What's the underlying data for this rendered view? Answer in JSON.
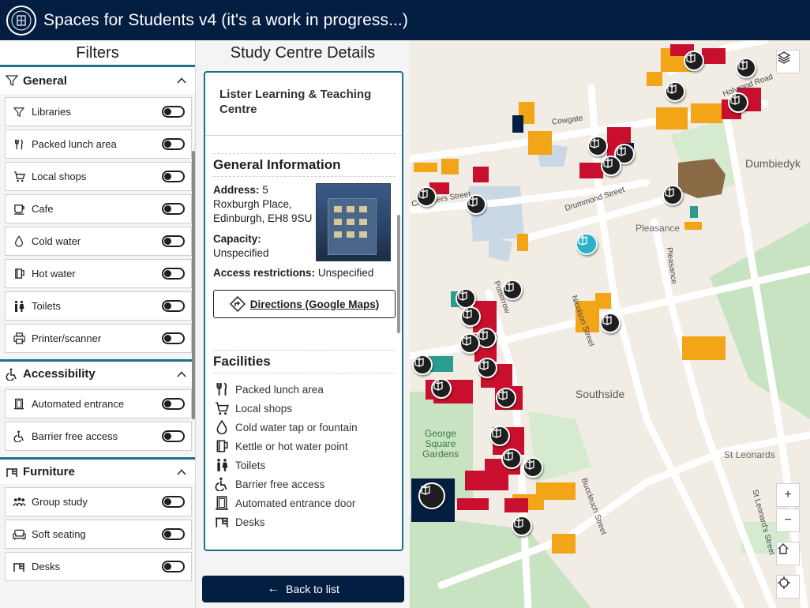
{
  "header": {
    "title": "Spaces for Students v4 (it's a work in progress...)",
    "logo_icon": "university-crest-icon"
  },
  "filters": {
    "title": "Filters",
    "groups": [
      {
        "label": "General",
        "icon": "filter-icon",
        "items": [
          {
            "label": "Libraries",
            "icon": "filter-icon",
            "on": false
          },
          {
            "label": "Packed lunch area",
            "icon": "cutlery-icon",
            "on": false
          },
          {
            "label": "Local shops",
            "icon": "cart-icon",
            "on": false
          },
          {
            "label": "Cafe",
            "icon": "cup-icon",
            "on": false
          },
          {
            "label": "Cold water",
            "icon": "water-drop-icon",
            "on": false
          },
          {
            "label": "Hot water",
            "icon": "kettle-icon",
            "on": false
          },
          {
            "label": "Toilets",
            "icon": "toilets-icon",
            "on": false
          },
          {
            "label": "Printer/scanner",
            "icon": "printer-icon",
            "on": false
          }
        ]
      },
      {
        "label": "Accessibility",
        "icon": "wheelchair-icon",
        "items": [
          {
            "label": "Automated entrance",
            "icon": "door-icon",
            "on": false
          },
          {
            "label": "Barrier free access",
            "icon": "wheelchair-icon",
            "on": false
          }
        ]
      },
      {
        "label": "Furniture",
        "icon": "desk-icon",
        "items": [
          {
            "label": "Group study",
            "icon": "group-icon",
            "on": false
          },
          {
            "label": "Soft seating",
            "icon": "sofa-icon",
            "on": false
          },
          {
            "label": "Desks",
            "icon": "desk-icon",
            "on": false
          }
        ]
      }
    ]
  },
  "details": {
    "title": "Study Centre Details",
    "name": "Lister Learning & Teaching Centre",
    "general_heading": "General Information",
    "address_label": "Address:",
    "address_value": "5 Roxburgh Place, Edinburgh, EH8 9SU",
    "capacity_label": "Capacity:",
    "capacity_value": "Unspecified",
    "access_label": "Access restrictions:",
    "access_value": "Unspecified",
    "directions_label": "Directions (Google Maps)",
    "facilities_heading": "Facilities",
    "facilities": [
      {
        "label": "Packed lunch area",
        "icon": "cutlery-icon"
      },
      {
        "label": "Local shops",
        "icon": "cart-icon"
      },
      {
        "label": "Cold water tap or fountain",
        "icon": "water-drop-icon"
      },
      {
        "label": "Kettle or hot water point",
        "icon": "kettle-icon"
      },
      {
        "label": "Toilets",
        "icon": "toilets-icon"
      },
      {
        "label": "Barrier free access",
        "icon": "wheelchair-icon"
      },
      {
        "label": "Automated entrance door",
        "icon": "door-icon"
      },
      {
        "label": "Desks",
        "icon": "desk-icon"
      }
    ],
    "back_label": "Back to list"
  },
  "map": {
    "labels": {
      "cowgate": "Cowgate",
      "holyrood": "Holyrood Road",
      "chambers": "Chambers Street",
      "drummond": "Drummond Street",
      "pleasance_street": "Pleasance",
      "pleasance_area": "Pleasance",
      "potterrow": "Potterrow",
      "nicolson": "Nicolson Street",
      "southside": "Southside",
      "george_square": "George Square Gardens",
      "st_leonards": "St Leonards",
      "st_leonards_street": "St Leonard's Street",
      "buccleuch": "Buccleuch Street",
      "dumbiedykes": "Dumbiedyk"
    },
    "controls": {
      "zoom_in": "+",
      "zoom_out": "−"
    },
    "colors": {
      "background": "#f1ece4",
      "university_red": "#c8102e",
      "orange": "#f2a516",
      "navy": "#041e42",
      "green": "#c8e3c2",
      "teal": "#2a9d8f",
      "selected": "#2bb0c8"
    }
  }
}
